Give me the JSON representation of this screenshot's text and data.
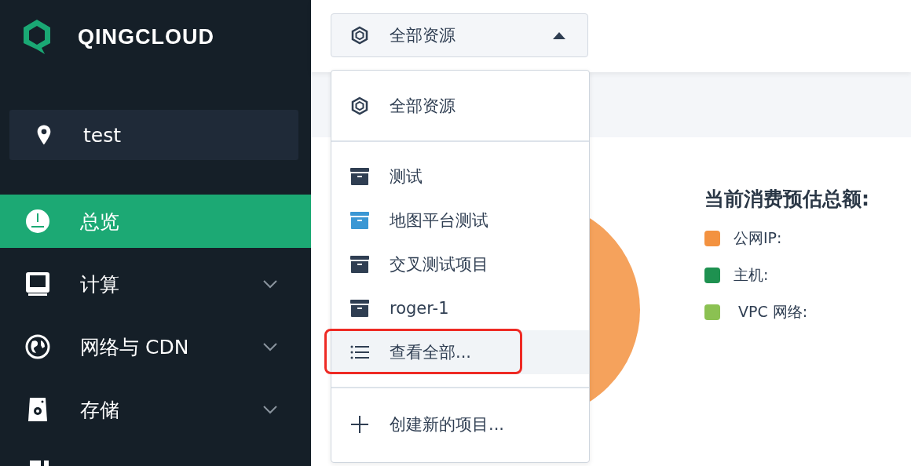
{
  "sidebar": {
    "logo": "QINGCLOUD",
    "zone": "test",
    "items": [
      {
        "kind": "gauge",
        "label": "总览",
        "selected": true,
        "expandable": false
      },
      {
        "kind": "monitor",
        "label": "计算",
        "selected": false,
        "expandable": true
      },
      {
        "kind": "globe",
        "label": "网络与 CDN",
        "selected": false,
        "expandable": true
      },
      {
        "kind": "drive",
        "label": "存储",
        "selected": false,
        "expandable": true
      }
    ]
  },
  "resource_selector": {
    "value": "全部资源",
    "expanded": true
  },
  "resource_menu": {
    "sections": [
      {
        "items": [
          {
            "kind": "all",
            "label": "全部资源",
            "selected": false,
            "annotated": false
          }
        ]
      },
      {
        "items": [
          {
            "kind": "project",
            "label": "测试",
            "color": "#2f3e52",
            "selected": false,
            "annotated": false
          },
          {
            "kind": "project",
            "label": "地图平台测试",
            "color": "#3a97d4",
            "selected": false,
            "annotated": false
          },
          {
            "kind": "project",
            "label": "交叉测试项目",
            "color": "#2f3e52",
            "selected": false,
            "annotated": false
          },
          {
            "kind": "project",
            "label": "roger-1",
            "color": "#2f3e52",
            "selected": false,
            "annotated": false
          },
          {
            "kind": "view_all",
            "label": "查看全部...",
            "selected": true,
            "annotated": true
          }
        ]
      },
      {
        "items": [
          {
            "kind": "create",
            "label": "创建新的项目...",
            "selected": false,
            "annotated": false
          }
        ]
      }
    ]
  },
  "cost_summary": {
    "title": "当前消费预估总额:",
    "legend": [
      {
        "label": "公网IP:",
        "color": "#f39240"
      },
      {
        "label": "主机:",
        "color": "#1e9150"
      },
      {
        "label": " VPC 网络:",
        "color": "#8bc152"
      }
    ]
  }
}
